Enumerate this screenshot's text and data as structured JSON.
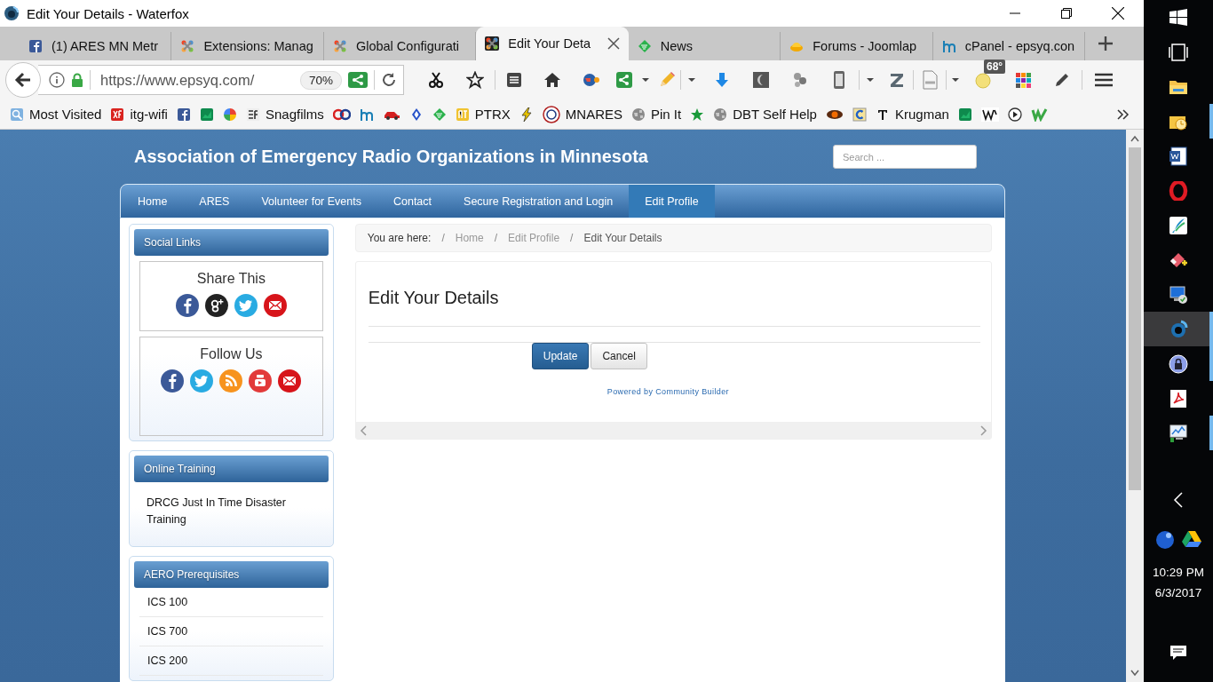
{
  "window": {
    "title": "Edit Your Details - Waterfox"
  },
  "tabs": [
    {
      "title": "(1) ARES MN Metr",
      "selected": false
    },
    {
      "title": "Extensions: Manag",
      "selected": false
    },
    {
      "title": "Global Configurati",
      "selected": false
    },
    {
      "title": "Edit Your Deta",
      "selected": true
    },
    {
      "title": "News",
      "selected": false
    },
    {
      "title": "Forums - Joomlap",
      "selected": false
    },
    {
      "title": "cPanel - epsyq.con",
      "selected": false
    }
  ],
  "toolbar": {
    "url": "https://www.epsyq.com/",
    "zoom": "70%",
    "weather_badge": "68°"
  },
  "bookmarks": [
    {
      "kind": "link",
      "label": "Most Visited"
    },
    {
      "kind": "link",
      "label": "itg-wifi"
    },
    {
      "kind": "icon"
    },
    {
      "kind": "icon"
    },
    {
      "kind": "icon"
    },
    {
      "kind": "link",
      "label": "Snagfilms"
    },
    {
      "kind": "icon"
    },
    {
      "kind": "icon"
    },
    {
      "kind": "icon"
    },
    {
      "kind": "icon"
    },
    {
      "kind": "icon"
    },
    {
      "kind": "link",
      "label": "PTRX"
    },
    {
      "kind": "icon"
    },
    {
      "kind": "link",
      "label": "MNARES"
    },
    {
      "kind": "link",
      "label": "Pin It"
    },
    {
      "kind": "icon"
    },
    {
      "kind": "link",
      "label": "DBT Self Help"
    },
    {
      "kind": "icon"
    },
    {
      "kind": "icon"
    },
    {
      "kind": "link",
      "label": "Krugman"
    },
    {
      "kind": "icon"
    },
    {
      "kind": "icon"
    },
    {
      "kind": "icon"
    },
    {
      "kind": "icon"
    }
  ],
  "site": {
    "title": "Association of Emergency Radio Organizations in Minnesota",
    "search_placeholder": "Search ...",
    "nav": [
      {
        "label": "Home",
        "selected": false
      },
      {
        "label": "ARES",
        "selected": false
      },
      {
        "label": "Volunteer for Events",
        "selected": false
      },
      {
        "label": "Contact",
        "selected": false
      },
      {
        "label": "Secure Registration and Login",
        "selected": false
      },
      {
        "label": "Edit Profile",
        "selected": true
      }
    ],
    "modules": [
      {
        "title": "Social Links",
        "kind": "social",
        "boxes": [
          {
            "title": "Share This"
          },
          {
            "title": "Follow Us"
          }
        ]
      },
      {
        "title": "Online Training",
        "kind": "links",
        "items": [
          "DRCG Just In Time Disaster Training"
        ]
      },
      {
        "title": "AERO Prerequisites",
        "kind": "list",
        "items": [
          "ICS 100",
          "ICS 700",
          "ICS 200"
        ]
      }
    ],
    "breadcrumb": {
      "label": "You are here:",
      "separator": "/",
      "items": [
        "Home",
        "Edit Profile",
        "Edit Your Details"
      ]
    },
    "content": {
      "heading": "Edit Your Details",
      "buttons": [
        {
          "label": "Update",
          "kind": "primary"
        },
        {
          "label": "Cancel",
          "kind": "default"
        }
      ],
      "footer_link": "Powered by Community Builder"
    }
  },
  "taskbar": {
    "apps": [
      {
        "running": false,
        "selected": false
      },
      {
        "running": true,
        "selected": false
      },
      {
        "running": false,
        "selected": false
      },
      {
        "running": false,
        "selected": false
      },
      {
        "running": false,
        "selected": false
      },
      {
        "running": false,
        "selected": false
      },
      {
        "running": false,
        "selected": false
      },
      {
        "running": true,
        "selected": true
      },
      {
        "running": true,
        "selected": false
      },
      {
        "running": false,
        "selected": false
      },
      {
        "running": true,
        "selected": false
      }
    ],
    "time": "10:29 PM",
    "date": "6/3/2017"
  }
}
